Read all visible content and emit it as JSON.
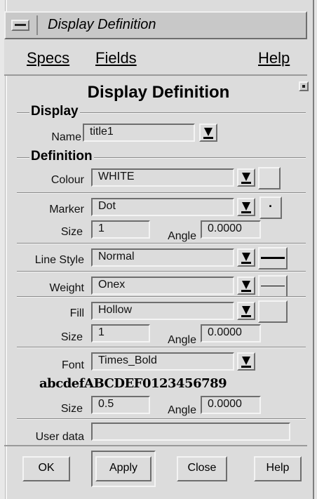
{
  "window": {
    "title": "Display Definition"
  },
  "menubar": {
    "specs": "Specs",
    "fields": "Fields",
    "help": "Help"
  },
  "panel": {
    "title": "Display Definition"
  },
  "display_group": {
    "label": "Display",
    "name_label": "Name",
    "name_value": "title1"
  },
  "definition_group": {
    "label": "Definition",
    "colour_label": "Colour",
    "colour_value": "WHITE",
    "marker_label": "Marker",
    "marker_value": "Dot",
    "marker_preview": "·",
    "marker_size_label": "Size",
    "marker_size_value": "1",
    "marker_angle_label": "Angle",
    "marker_angle_value": "0.0000",
    "line_style_label": "Line Style",
    "line_style_value": "Normal",
    "weight_label": "Weight",
    "weight_value": "Onex",
    "fill_label": "Fill",
    "fill_value": "Hollow",
    "fill_size_label": "Size",
    "fill_size_value": "1",
    "fill_angle_label": "Angle",
    "fill_angle_value": "0.0000",
    "font_label": "Font",
    "font_value": "Times_Bold",
    "font_sample": "abcdefABCDEF0123456789",
    "font_size_label": "Size",
    "font_size_value": "0.5",
    "font_angle_label": "Angle",
    "font_angle_value": "0.0000",
    "user_data_label": "User data",
    "user_data_value": ""
  },
  "buttons": {
    "ok": "OK",
    "apply": "Apply",
    "close": "Close",
    "help": "Help"
  },
  "icons": {
    "window_menu": "window-menu-icon",
    "dropdown": "dropdown-arrow-icon"
  }
}
